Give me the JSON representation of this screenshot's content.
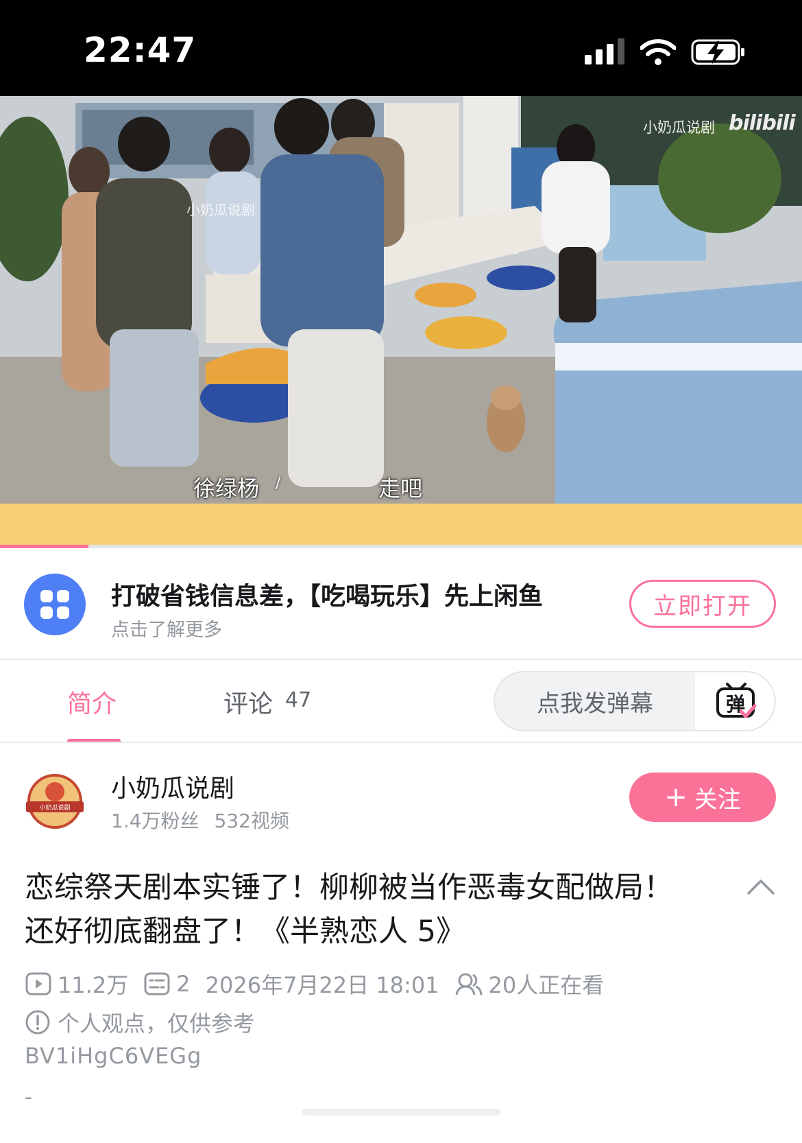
{
  "status_bar": {
    "time": "22:47",
    "icons": [
      "cellular-signal-icon",
      "wifi-icon",
      "battery-charging-icon"
    ]
  },
  "video": {
    "watermark_text": "小奶瓜说剧",
    "watermark_logo": "bilibili",
    "inner_watermark": "小奶瓜说剧",
    "subtitle_left": "徐绿杨",
    "subtitle_slash": "/",
    "subtitle_right": "走吧",
    "progress": 0.11
  },
  "ad": {
    "icon": "app-grid-icon",
    "title": "打破省钱信息差，【吃喝玩乐】先上闲鱼",
    "subtitle": "点击了解更多",
    "button_label": "立即打开"
  },
  "tabs": {
    "intro_label": "简介",
    "comments_label": "评论",
    "comments_count": "47",
    "danmaku_placeholder": "点我发弹幕",
    "danmaku_icon_text": "弹"
  },
  "uploader": {
    "name": "小奶瓜说剧",
    "fans": "1.4万粉丝",
    "videos": "532视频",
    "avatar_text": "小奶瓜说剧",
    "follow_plus": "+",
    "follow_label": "关注"
  },
  "video_info": {
    "title": "恋综祭天剧本实锤了！柳柳被当作恶毒女配做局！还好彻底翻盘了！《半熟恋人 5》",
    "views": "11.2万",
    "danmaku_count": "2",
    "datetime": "2026年7月22日 18:01",
    "watching": "20人正在看",
    "note": "个人观点，仅供参考",
    "bvid": "BV1iHgC6VEGg",
    "desc": "-"
  },
  "colors": {
    "accent_pink": "#fb7299",
    "ad_icon_blue": "#4f7ff5",
    "text_primary": "#18191c",
    "text_secondary": "#9499a0",
    "video_band_yellow": "#f7cf73"
  }
}
